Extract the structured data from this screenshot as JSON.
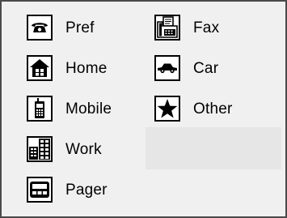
{
  "categories": [
    {
      "id": "pref",
      "label": "Pref",
      "icon": "phone-icon"
    },
    {
      "id": "home",
      "label": "Home",
      "icon": "house-icon"
    },
    {
      "id": "mobile",
      "label": "Mobile",
      "icon": "mobile-phone-icon"
    },
    {
      "id": "work",
      "label": "Work",
      "icon": "building-icon"
    },
    {
      "id": "pager",
      "label": "Pager",
      "icon": "pager-icon"
    },
    {
      "id": "fax",
      "label": "Fax",
      "icon": "fax-icon"
    },
    {
      "id": "car",
      "label": "Car",
      "icon": "car-icon"
    },
    {
      "id": "other",
      "label": "Other",
      "icon": "star-icon"
    }
  ],
  "colors": {
    "background": "#f0f0f0",
    "border": "#4a4a4a",
    "icon_fill": "#000000",
    "empty_cell": "#e6e6e6"
  }
}
